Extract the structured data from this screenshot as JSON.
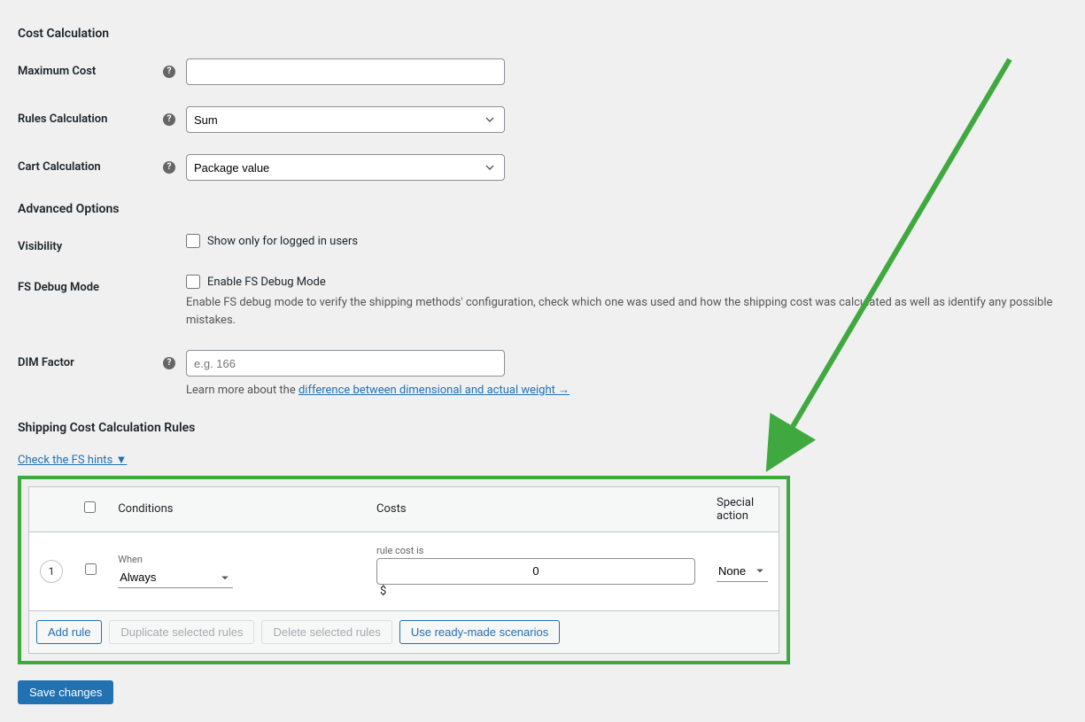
{
  "sections": {
    "cost_calc": "Cost Calculation",
    "advanced": "Advanced Options",
    "shipping_rules": "Shipping Cost Calculation Rules"
  },
  "labels": {
    "max_cost": "Maximum Cost",
    "rules_calc": "Rules Calculation",
    "cart_calc": "Cart Calculation",
    "visibility": "Visibility",
    "fs_debug": "FS Debug Mode",
    "dim_factor": "DIM Factor"
  },
  "fields": {
    "max_cost_value": "",
    "rules_calc_value": "Sum",
    "cart_calc_value": "Package value",
    "visibility_checkbox": "Show only for logged in users",
    "fs_debug_checkbox": "Enable FS Debug Mode",
    "fs_debug_help": "Enable FS debug mode to verify the shipping methods' configuration, check which one was used and how the shipping cost was calculated as well as identify any possible mistakes.",
    "dim_placeholder": "e.g. 166",
    "dim_help_prefix": "Learn more about the ",
    "dim_help_link": "difference between dimensional and actual weight →"
  },
  "hints_link": "Check the FS hints ▼",
  "table": {
    "headers": {
      "conditions": "Conditions",
      "costs": "Costs",
      "special": "Special action"
    },
    "row": {
      "num": "1",
      "when_label": "When",
      "when_value": "Always",
      "cost_label": "rule cost is",
      "cost_value": "0",
      "currency": "$",
      "special_value": "None"
    },
    "buttons": {
      "add": "Add rule",
      "duplicate": "Duplicate selected rules",
      "delete": "Delete selected rules",
      "scenarios": "Use ready-made scenarios"
    }
  },
  "save": "Save changes"
}
